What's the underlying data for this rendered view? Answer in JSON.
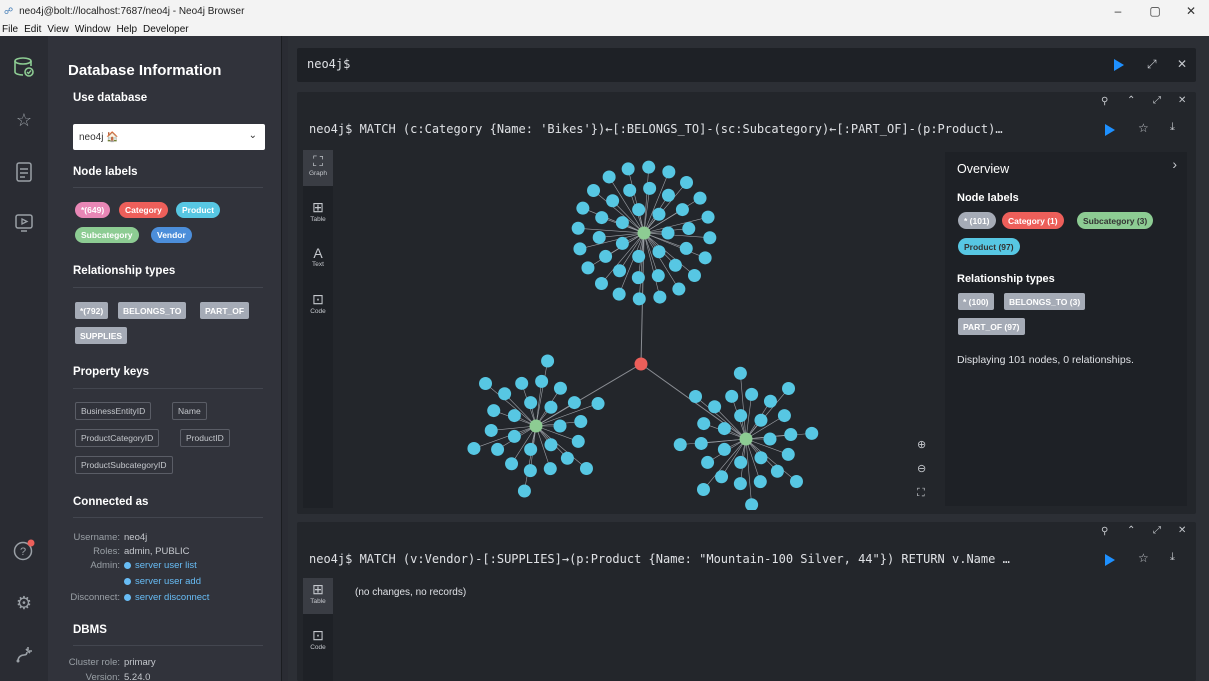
{
  "window": {
    "title": "neo4j@bolt://localhost:7687/neo4j - Neo4j Browser",
    "app_icon": "neo4j-icon",
    "controls": [
      "–",
      "▢",
      "✕"
    ]
  },
  "menubar": [
    "File",
    "Edit",
    "View",
    "Window",
    "Help",
    "Developer"
  ],
  "sidebar_icons": [
    "database-icon",
    "star-icon",
    "document-icon",
    "monitor-play-icon",
    "help-icon",
    "gear-icon",
    "plug-icon"
  ],
  "drawer": {
    "title": "Database Information",
    "use_database_label": "Use database",
    "database_selected": "neo4j 🏠",
    "node_labels_heading": "Node labels",
    "node_labels": [
      {
        "text": "*(649)",
        "color": "#e887b6"
      },
      {
        "text": "Category",
        "color": "#ed5f5a"
      },
      {
        "text": "Product",
        "color": "#57c7e3"
      },
      {
        "text": "Subcategory",
        "color": "#8dcc93"
      },
      {
        "text": "Vendor",
        "color": "#4c8eda"
      }
    ],
    "relationship_types_heading": "Relationship types",
    "relationship_types": [
      "*(792)",
      "BELONGS_TO",
      "PART_OF",
      "SUPPLIES"
    ],
    "property_keys_heading": "Property keys",
    "property_keys": [
      "BusinessEntityID",
      "Name",
      "ProductCategoryID",
      "ProductID",
      "ProductSubcategoryID"
    ],
    "connected_as_heading": "Connected as",
    "username_label": "Username:",
    "username": "neo4j",
    "roles_label": "Roles:",
    "roles": "admin, PUBLIC",
    "admin_label": "Admin:",
    "admin_links": [
      "server user list",
      "server user add"
    ],
    "disconnect_label": "Disconnect:",
    "disconnect_link": "server disconnect",
    "dbms_heading": "DBMS",
    "cluster_role_label": "Cluster role:",
    "cluster_role": "primary",
    "version_label": "Version:",
    "version": "5.24.0"
  },
  "editor": {
    "prompt": "neo4j$"
  },
  "frame1": {
    "query": "neo4j$ MATCH (c:Category {Name: 'Bikes'})←[:BELONGS_TO]-(sc:Subcategory)←[:PART_OF]-(p:Product)…",
    "tabs": [
      "Graph",
      "Table",
      "Text",
      "Code"
    ],
    "overview": {
      "title": "Overview",
      "node_labels_heading": "Node labels",
      "node_labels": [
        {
          "text": "* (101)",
          "color": "#a5abb6"
        },
        {
          "text": "Category (1)",
          "color": "#ed5f5a"
        },
        {
          "text": "Subcategory (3)",
          "color": "#8dcc93"
        },
        {
          "text": "Product (97)",
          "color": "#57c7e3"
        }
      ],
      "relationship_types_heading": "Relationship types",
      "relationship_types": [
        "* (100)",
        "BELONGS_TO (3)",
        "PART_OF (97)"
      ],
      "status": "Displaying 101 nodes, 0 relationships."
    },
    "graph": {
      "category_color": "#ed5f5a",
      "subcategory_color": "#8dcc93",
      "product_color": "#57c7e3"
    }
  },
  "frame2": {
    "query": "neo4j$ MATCH (v:Vendor)-[:SUPPLIES]→(p:Product {Name: \"Mountain-100 Silver, 44\"}) RETURN v.Name …",
    "tabs": [
      "Table",
      "Code"
    ],
    "result": "(no changes, no records)"
  }
}
